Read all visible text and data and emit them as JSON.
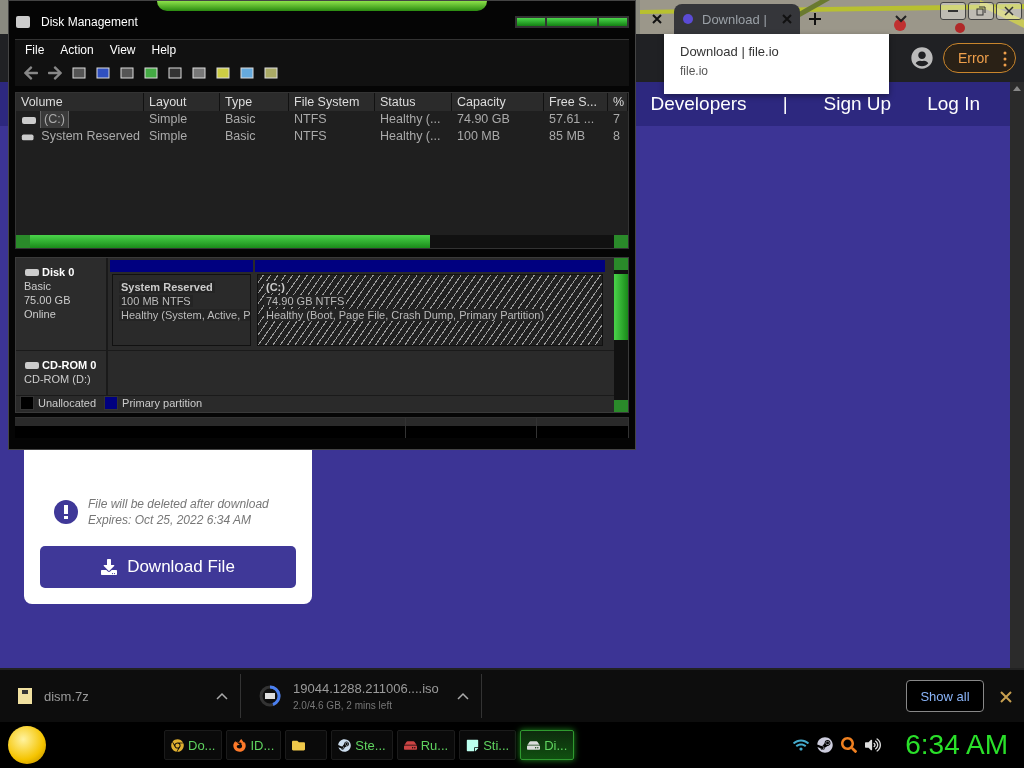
{
  "browser": {
    "tabs": [
      {
        "selected": false
      },
      {
        "label": "Download |",
        "selected": true
      }
    ],
    "tooltip": {
      "title": "Download | file.io",
      "url": "file.io"
    },
    "error_button": "Error",
    "nav": [
      "Developers",
      "|",
      "Sign Up",
      "Log In"
    ],
    "card": {
      "notice": [
        "File will be deleted after download",
        "Expires: Oct 25, 2022 6:34 AM"
      ],
      "button": "Download File"
    }
  },
  "downloads": {
    "items": [
      {
        "kind": "file",
        "name": "dism.7z"
      },
      {
        "kind": "progress",
        "name": "19044.1288.211006....iso",
        "status": "2.0/4.6 GB, 2 mins left"
      }
    ],
    "show_all": "Show all"
  },
  "taskbar": {
    "tasks": [
      {
        "label": "Do...",
        "selected": false
      },
      {
        "selected": false,
        "label": "ID..."
      },
      {
        "selected": false
      },
      {
        "label": "Ste...",
        "selected": false
      },
      {
        "label": "Ru...",
        "selected": false
      },
      {
        "label": "Sti...",
        "selected": false
      },
      {
        "label": "Di...",
        "selected": true
      }
    ],
    "clock": "6:34 AM"
  },
  "disk_management": {
    "title": "Disk Management",
    "menu": [
      "File",
      "Action",
      "View",
      "Help"
    ],
    "columns": [
      "Volume",
      "Layout",
      "Type",
      "File System",
      "Status",
      "Capacity",
      "Free S...",
      "%"
    ],
    "rows": [
      {
        "cells": [
          "(C:)",
          "Simple",
          "Basic",
          "NTFS",
          "Healthy (...",
          "74.90 GB",
          "57.61 ...",
          "7"
        ],
        "selected": true
      },
      {
        "cells": [
          "System Reserved",
          "Simple",
          "Basic",
          "NTFS",
          "Healthy (...",
          "100 MB",
          "85 MB",
          "8"
        ],
        "selected": false
      }
    ],
    "disks": [
      {
        "name": "Disk 0",
        "lines": [
          "Basic",
          "75.00 GB",
          "Online"
        ],
        "partitions": [
          {
            "name": "System Reserved",
            "size": "100 MB NTFS",
            "status": "Healthy (System, Active, P",
            "selected": false
          },
          {
            "name": "(C:)",
            "size": "74.90 GB NTFS",
            "status": "Healthy (Boot, Page File, Crash Dump, Primary Partition)",
            "selected": true
          }
        ]
      },
      {
        "name": "CD-ROM 0",
        "lines": [
          "CD-ROM (D:)"
        ]
      }
    ],
    "legend": [
      {
        "label": "Unallocated",
        "color": "#000000"
      },
      {
        "label": "Primary partition",
        "color": "#000080"
      }
    ]
  }
}
